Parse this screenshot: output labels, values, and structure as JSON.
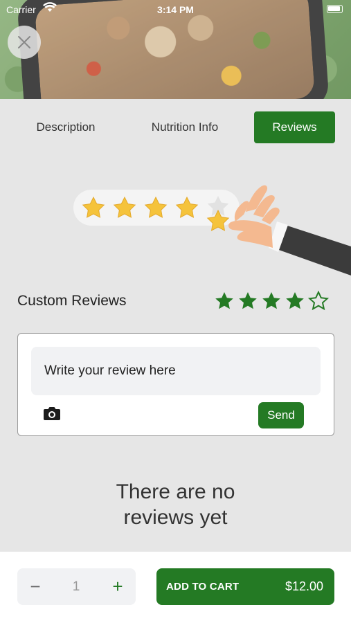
{
  "status_bar": {
    "carrier": "Carrier",
    "time": "3:14 PM"
  },
  "tabs": [
    {
      "label": "Description",
      "active": false
    },
    {
      "label": "Nutrition Info",
      "active": false
    },
    {
      "label": "Reviews",
      "active": true
    }
  ],
  "custom_reviews": {
    "title": "Custom Reviews",
    "rating": 4,
    "max_rating": 5,
    "input_placeholder": "Write your review here",
    "send_label": "Send"
  },
  "empty_message": "There are no\nreviews yet",
  "cart": {
    "quantity": "1",
    "minus_symbol": "−",
    "plus_symbol": "+",
    "add_label": "ADD TO CART",
    "price": "$12.00"
  },
  "colors": {
    "accent": "#247a24",
    "star_gold": "#f5c33b",
    "background": "#e6e6e6"
  },
  "icons": [
    "close-icon",
    "camera-icon",
    "star-icon",
    "star-outline-icon",
    "wifi-icon",
    "battery-icon"
  ]
}
